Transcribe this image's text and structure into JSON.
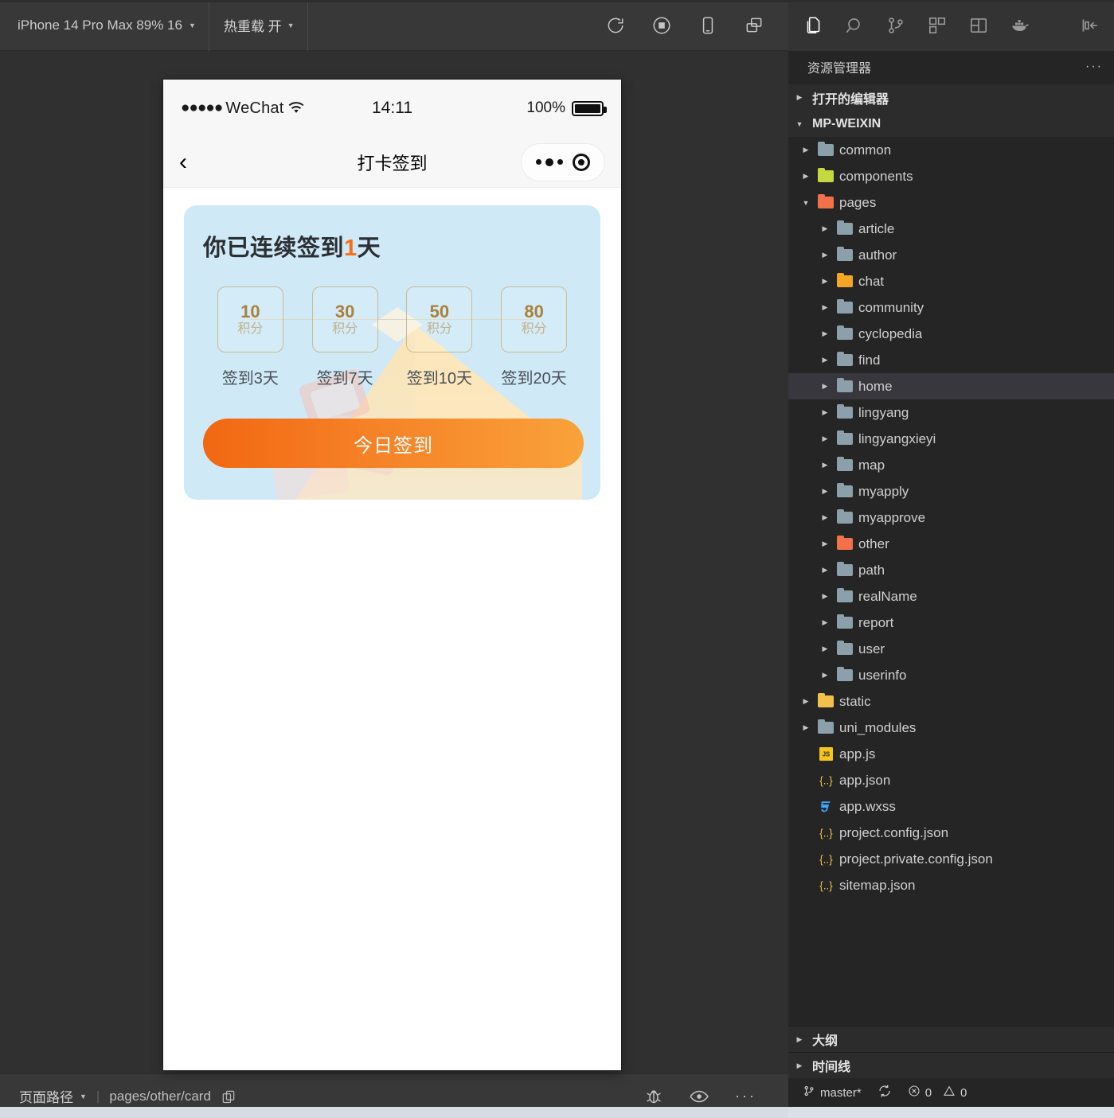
{
  "devtools": {
    "toolbar": {
      "device_label": "iPhone 14 Pro Max 89% 16",
      "hot_reload_label": "热重载 开",
      "icons": [
        "refresh-icon",
        "stop-record-icon",
        "device-preview-icon",
        "multi-window-icon"
      ]
    },
    "simulator": {
      "status_bar": {
        "carrier": "WeChat",
        "signal_dots": "●●●●●",
        "time": "14:11",
        "battery_percent": "100%"
      },
      "nav_bar": {
        "back_icon": "chevron-left-icon",
        "title": "打卡签到",
        "capsule": {
          "more_icon": "more-dots-icon",
          "close_icon": "target-circle-icon"
        }
      },
      "signin_card": {
        "title_prefix": "你已连续签到",
        "title_count": "1",
        "title_suffix": "天",
        "unit": "积分",
        "steps": [
          {
            "points": "10",
            "unit": "积分",
            "label": "签到3天"
          },
          {
            "points": "30",
            "unit": "积分",
            "label": "签到7天"
          },
          {
            "points": "50",
            "unit": "积分",
            "label": "签到10天"
          },
          {
            "points": "80",
            "unit": "积分",
            "label": "签到20天"
          }
        ],
        "button_label": "今日签到",
        "colors": {
          "card_bg": "#cfe9f7",
          "accent": "#ff6a17",
          "button_gradient_start": "#f26712",
          "button_gradient_end": "#f9a23a",
          "points_text": "#a8823c",
          "box_border": "#cbbb93"
        }
      }
    },
    "bottom_bar": {
      "page_path_label": "页面路径",
      "separator": "|",
      "current_path": "pages/other/card",
      "copy_icon": "copy-icon",
      "right_icons": [
        "bug-icon",
        "eye-icon",
        "more-horizontal-icon"
      ]
    }
  },
  "vscode": {
    "activity_bar": {
      "items": [
        {
          "name": "explorer-icon",
          "active": true
        },
        {
          "name": "search-icon",
          "active": false
        },
        {
          "name": "source-control-icon",
          "active": false
        },
        {
          "name": "extensions-icon",
          "active": false
        },
        {
          "name": "layout-panel-icon",
          "active": false
        },
        {
          "name": "docker-icon",
          "active": false
        }
      ],
      "collapse_icon": "collapse-sidebar-icon"
    },
    "explorer": {
      "title": "资源管理器",
      "more_actions": "···",
      "sections": [
        {
          "label": "打开的编辑器",
          "expanded": false
        },
        {
          "label": "MP-WEIXIN",
          "expanded": true
        }
      ],
      "tree": [
        {
          "label": "common",
          "type": "folder",
          "depth": 1,
          "expanded": false,
          "color": "#8ca0ab",
          "selected": false
        },
        {
          "label": "components",
          "type": "folder",
          "depth": 1,
          "expanded": false,
          "color": "#c4d83f",
          "selected": false
        },
        {
          "label": "pages",
          "type": "folder",
          "depth": 1,
          "expanded": true,
          "color": "#f2714b",
          "selected": false
        },
        {
          "label": "article",
          "type": "folder",
          "depth": 2,
          "expanded": false,
          "color": "#8ca0ab",
          "selected": false
        },
        {
          "label": "author",
          "type": "folder",
          "depth": 2,
          "expanded": false,
          "color": "#8ca0ab",
          "selected": false
        },
        {
          "label": "chat",
          "type": "folder",
          "depth": 2,
          "expanded": false,
          "color": "#f5a623",
          "selected": false
        },
        {
          "label": "community",
          "type": "folder",
          "depth": 2,
          "expanded": false,
          "color": "#8ca0ab",
          "selected": false
        },
        {
          "label": "cyclopedia",
          "type": "folder",
          "depth": 2,
          "expanded": false,
          "color": "#8ca0ab",
          "selected": false
        },
        {
          "label": "find",
          "type": "folder",
          "depth": 2,
          "expanded": false,
          "color": "#8ca0ab",
          "selected": false
        },
        {
          "label": "home",
          "type": "folder",
          "depth": 2,
          "expanded": false,
          "color": "#8ca0ab",
          "selected": true
        },
        {
          "label": "lingyang",
          "type": "folder",
          "depth": 2,
          "expanded": false,
          "color": "#8ca0ab",
          "selected": false
        },
        {
          "label": "lingyangxieyi",
          "type": "folder",
          "depth": 2,
          "expanded": false,
          "color": "#8ca0ab",
          "selected": false
        },
        {
          "label": "map",
          "type": "folder",
          "depth": 2,
          "expanded": false,
          "color": "#8ca0ab",
          "selected": false
        },
        {
          "label": "myapply",
          "type": "folder",
          "depth": 2,
          "expanded": false,
          "color": "#8ca0ab",
          "selected": false
        },
        {
          "label": "myapprove",
          "type": "folder",
          "depth": 2,
          "expanded": false,
          "color": "#8ca0ab",
          "selected": false
        },
        {
          "label": "other",
          "type": "folder",
          "depth": 2,
          "expanded": false,
          "color": "#f2714b",
          "selected": false
        },
        {
          "label": "path",
          "type": "folder",
          "depth": 2,
          "expanded": false,
          "color": "#8ca0ab",
          "selected": false
        },
        {
          "label": "realName",
          "type": "folder",
          "depth": 2,
          "expanded": false,
          "color": "#8ca0ab",
          "selected": false
        },
        {
          "label": "report",
          "type": "folder",
          "depth": 2,
          "expanded": false,
          "color": "#8ca0ab",
          "selected": false
        },
        {
          "label": "user",
          "type": "folder",
          "depth": 2,
          "expanded": false,
          "color": "#8ca0ab",
          "selected": false
        },
        {
          "label": "userinfo",
          "type": "folder",
          "depth": 2,
          "expanded": false,
          "color": "#8ca0ab",
          "selected": false
        },
        {
          "label": "static",
          "type": "folder",
          "depth": 1,
          "expanded": false,
          "color": "#f0c04a",
          "selected": false
        },
        {
          "label": "uni_modules",
          "type": "folder",
          "depth": 1,
          "expanded": false,
          "color": "#8ca0ab",
          "selected": false
        },
        {
          "label": "app.js",
          "type": "file",
          "depth": 1,
          "icon": "js-file-icon",
          "color": "#f5c518",
          "selected": false
        },
        {
          "label": "app.json",
          "type": "file",
          "depth": 1,
          "icon": "json-file-icon",
          "color": "#f0c04a",
          "selected": false
        },
        {
          "label": "app.wxss",
          "type": "file",
          "depth": 1,
          "icon": "css-file-icon",
          "color": "#42a5f5",
          "selected": false
        },
        {
          "label": "project.config.json",
          "type": "file",
          "depth": 1,
          "icon": "json-file-icon",
          "color": "#f0c04a",
          "selected": false
        },
        {
          "label": "project.private.config.json",
          "type": "file",
          "depth": 1,
          "icon": "json-file-icon",
          "color": "#f0c04a",
          "selected": false
        },
        {
          "label": "sitemap.json",
          "type": "file",
          "depth": 1,
          "icon": "json-file-icon",
          "color": "#f0c04a",
          "selected": false
        }
      ]
    },
    "panels": [
      {
        "label": "大纲",
        "expanded": false
      },
      {
        "label": "时间线",
        "expanded": false
      }
    ],
    "status_bar": {
      "branch_icon": "source-control-branch-icon",
      "branch": "master*",
      "sync_icon": "sync-icon",
      "error_icon": "error-icon",
      "errors": "0",
      "warning_icon": "warning-icon",
      "warnings": "0"
    }
  }
}
